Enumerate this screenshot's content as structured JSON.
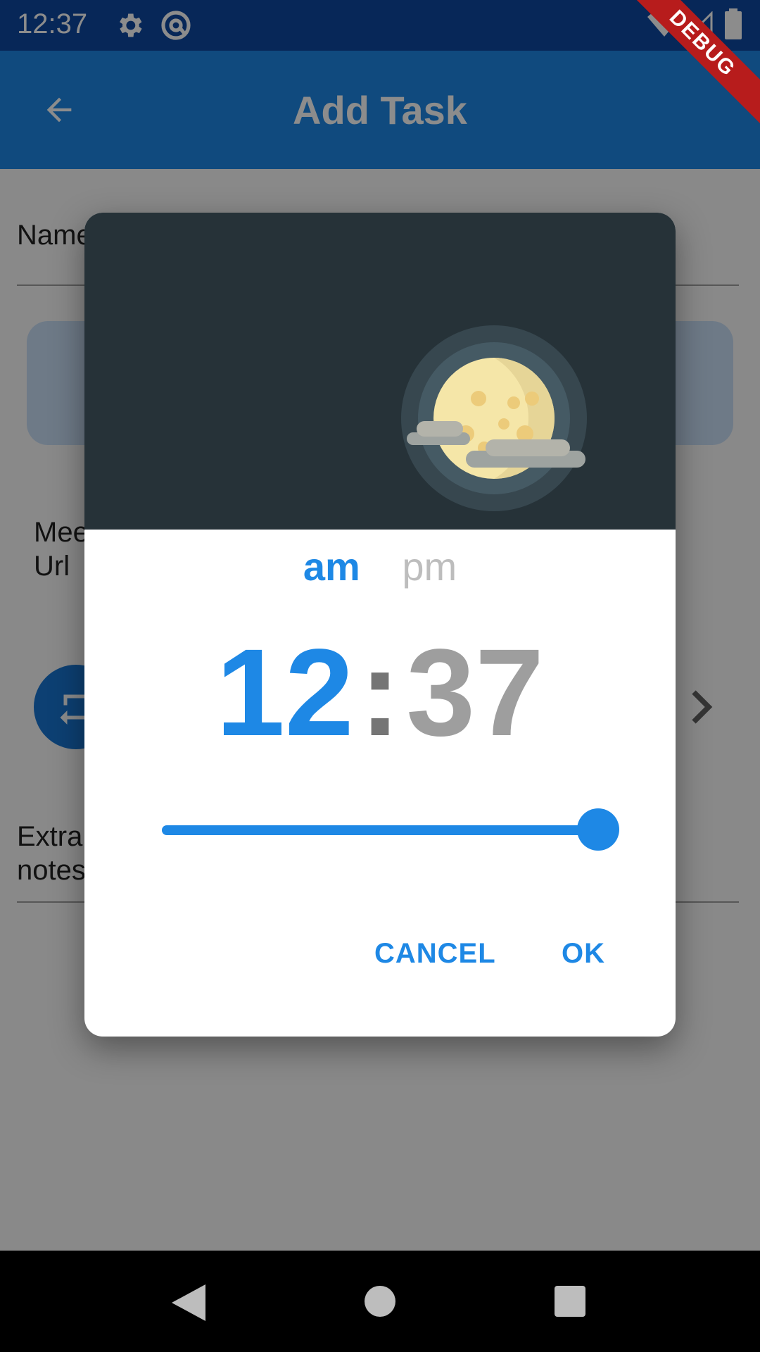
{
  "status_bar": {
    "time": "12:37",
    "icons": [
      "gear-icon",
      "at-sign-icon",
      "wifi-icon",
      "signal-icon",
      "battery-icon"
    ]
  },
  "app_bar": {
    "title": "Add Task",
    "back_icon": "arrow-back-icon",
    "color": "#1e88e5"
  },
  "debug_banner": "DEBUG",
  "form": {
    "name_label": "Name",
    "meeting_url_label": "Meet\nUrl",
    "extra_notes_label": "Extra\nnotes"
  },
  "dialog": {
    "am": "am",
    "pm": "pm",
    "selected_period": "am",
    "hour": "12",
    "separator": ":",
    "minute": "37",
    "slider_value_fraction": 1.0,
    "cancel_label": "CANCEL",
    "ok_label": "OK",
    "header_color": "#263238",
    "accent_color": "#1e88e5"
  },
  "nav_bar": {
    "icons": [
      "back-triangle-icon",
      "home-circle-icon",
      "recents-square-icon"
    ]
  }
}
